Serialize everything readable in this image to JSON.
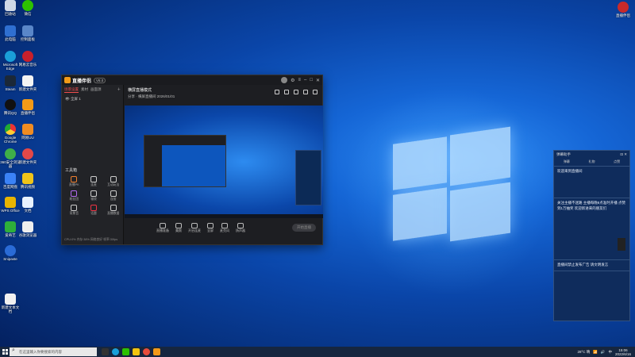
{
  "desktop": {
    "icons_left_col1": [
      "回收站",
      "此电脑",
      "Microsoft Edge",
      "Steam",
      "腾讯QQ",
      "Google Chrome",
      "360安全浏览器",
      "百度网盘",
      "WPS Office",
      "爱奇艺",
      "Snipaste",
      "新建文本文档"
    ],
    "icons_left_col2": [
      "微信",
      "控制面板",
      "网易云音乐",
      "新建文件夹",
      "直播伴侣",
      "网易UU",
      "新建文件夹",
      "腾讯视频",
      "文档",
      "谷歌浏览器"
    ],
    "top_right_icon": "直播伴侣"
  },
  "app": {
    "name": "直播伴侣",
    "version": "V8.0",
    "tabs": [
      "场景设置",
      "素材",
      "画面源"
    ],
    "scene_label": "全屏 1",
    "tools_label": "工具箱",
    "tools": [
      "直播PK",
      "连麦",
      "互动玩法",
      "粉丝团",
      "福袋",
      "连接",
      "背景音",
      "话题",
      "直播数据"
    ],
    "room_title": "横屏直播模式",
    "room_sub": "分享 · 横屏直播间  2026/01/01",
    "controls": [
      "直播准备",
      "美颜",
      "开启连麦",
      "全屏",
      "麦克风",
      "扬声器"
    ],
    "start_live": "开始直播",
    "status": "CPU:0%  内存:38%  网络良好  帧率:30fps"
  },
  "notification": {
    "title": "弹幕助手",
    "tabs": [
      "弹幕",
      "礼物",
      "点赞"
    ],
    "blocks": [
      "欢迎来到直播间",
      "关注主播不迷路 主播每晚8点准时开播 点赞到1万抽奖 欢迎新进来的朋友们",
      "直播间禁止发布广告 请文明发言"
    ]
  },
  "taskbar": {
    "search_placeholder": "在这里输入你要搜索的内容",
    "weather": "28°C 晴",
    "lang": "中",
    "time": "15:06",
    "date": "2022/6/16"
  }
}
